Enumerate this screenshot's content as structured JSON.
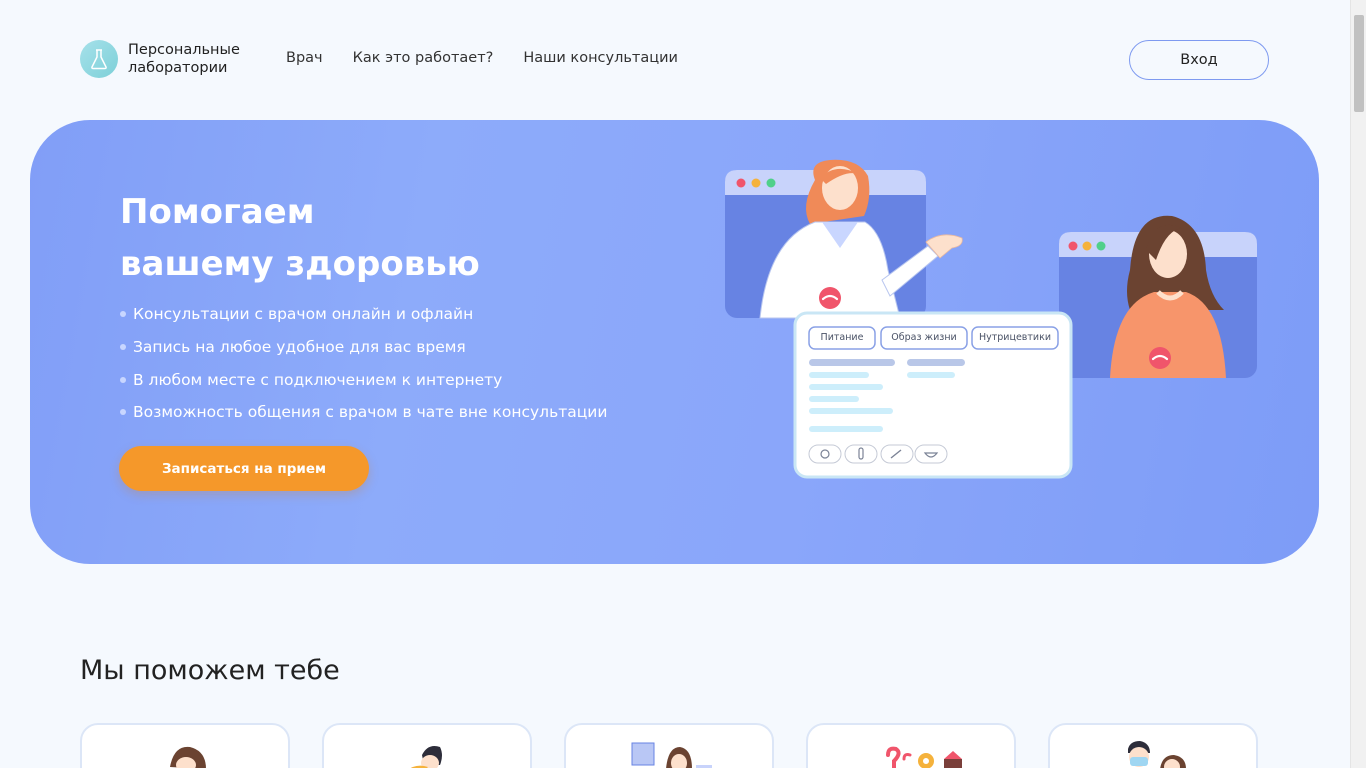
{
  "header": {
    "logo_text": "Персональные лаборатории",
    "nav": [
      "Врач",
      "Как это работает?",
      "Наши консультации"
    ],
    "login_label": "Вход"
  },
  "hero": {
    "title_line1": "Помогаем",
    "title_line2": "вашему здоровью",
    "bullets": [
      "Консультации с врачом онлайн и офлайн",
      "Запись на любое удобное для вас время",
      "В любом месте с подключением к интернету",
      "Возможность общения с врачом в чате вне консультации"
    ],
    "cta_label": "Записаться на прием",
    "chat_tabs": [
      "Питание",
      "Образ жизни",
      "Нутрицевтики"
    ]
  },
  "section": {
    "title": "Мы поможем тебе"
  },
  "colors": {
    "accent": "#f5982a",
    "hero_bg": "#8aa6fa",
    "window_bg": "#6783e3"
  },
  "icons": [
    "flask-icon",
    "hangup-icon",
    "food-icon",
    "bottle-icon",
    "spoon-icon",
    "bowl-icon"
  ]
}
